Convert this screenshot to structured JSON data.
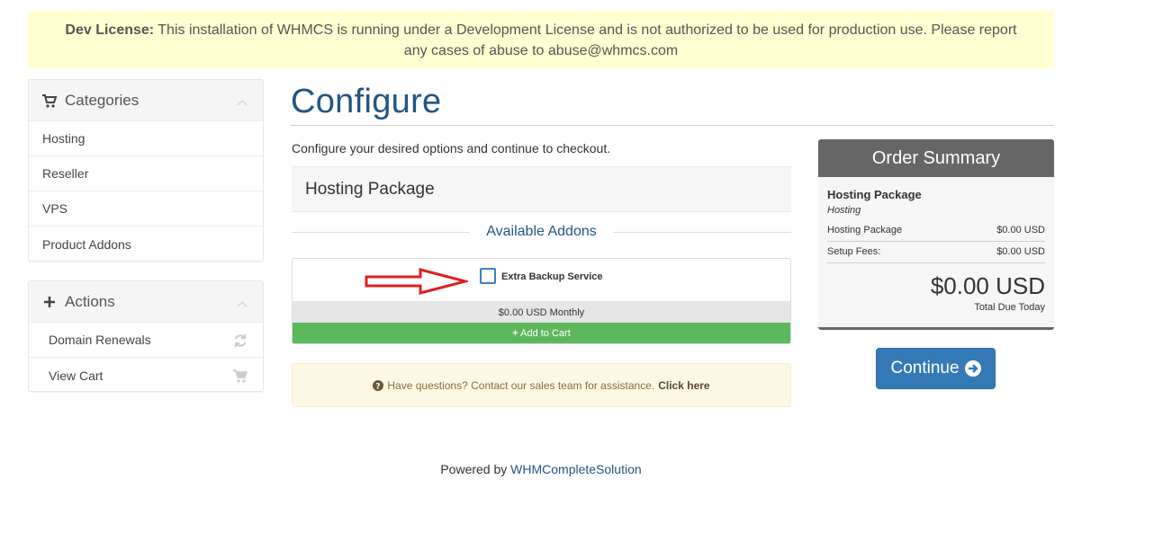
{
  "dev_notice": {
    "label": "Dev License:",
    "text": " This installation of WHMCS is running under a Development License and is not authorized to be used for production use. Please report any cases of abuse to abuse@whmcs.com"
  },
  "sidebar": {
    "categories": {
      "title": "Categories",
      "items": [
        "Hosting",
        "Reseller",
        "VPS",
        "Product Addons"
      ]
    },
    "actions": {
      "title": "Actions",
      "items": [
        {
          "label": "Domain Renewals",
          "icon": "refresh-icon"
        },
        {
          "label": "View Cart",
          "icon": "cart-icon"
        }
      ]
    }
  },
  "main": {
    "title": "Configure",
    "intro": "Configure your desired options and continue to checkout.",
    "product_name": "Hosting Package",
    "addons_heading": "Available Addons",
    "addon": {
      "name": "Extra Backup Service",
      "price": "$0.00 USD Monthly",
      "add_label": "Add to Cart",
      "checked": false
    },
    "help": {
      "text": "Have questions? Contact our sales team for assistance.",
      "link": "Click here"
    }
  },
  "summary": {
    "title": "Order Summary",
    "product": "Hosting Package",
    "group": "Hosting",
    "rows": [
      {
        "label": "Hosting Package",
        "value": "$0.00 USD"
      },
      {
        "label": "Setup Fees:",
        "value": "$0.00 USD"
      }
    ],
    "total": "$0.00 USD",
    "total_label": "Total Due Today"
  },
  "continue_label": "Continue",
  "footer": {
    "prefix": "Powered by ",
    "link": "WHMCompleteSolution"
  },
  "colors": {
    "brand_blue": "#245580",
    "button_blue": "#337ab7",
    "success_green": "#5cb85c",
    "notice_yellow": "#ffffd2",
    "arrow_red": "#e02020"
  }
}
